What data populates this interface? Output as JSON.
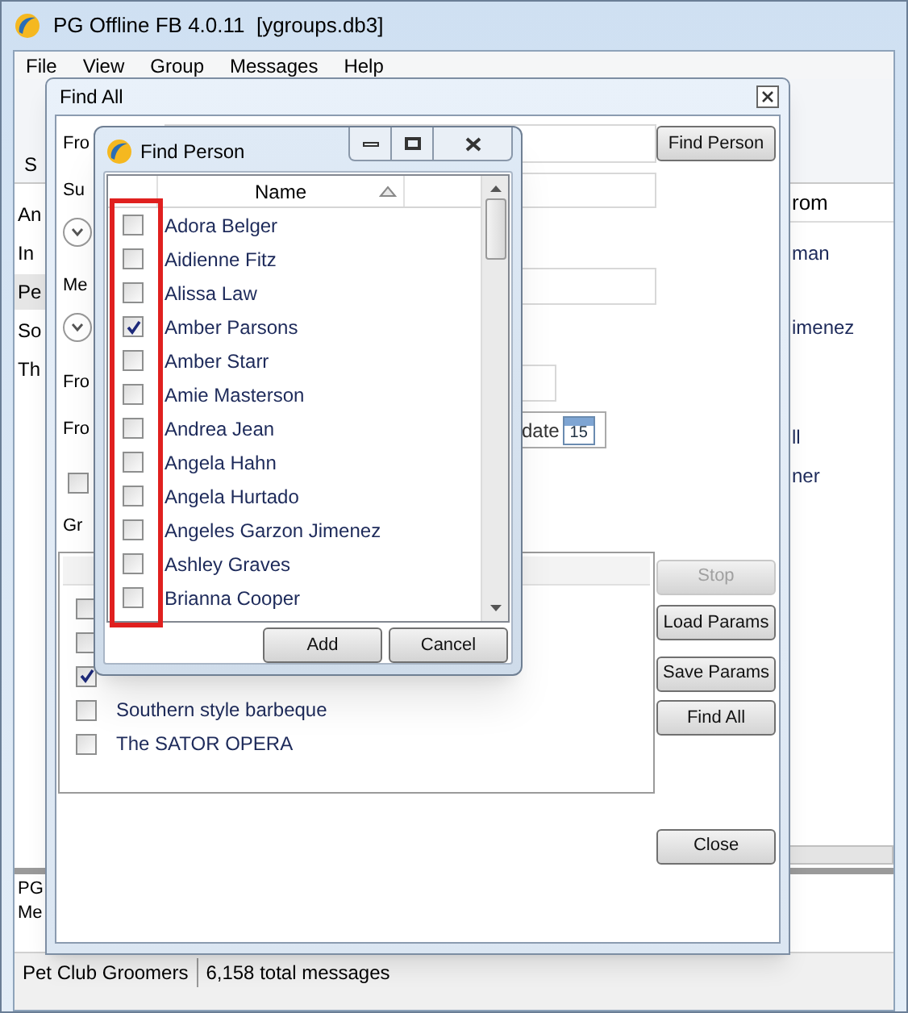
{
  "main_window": {
    "title": "PG Offline FB 4.0.11  [ygroups.db3]",
    "menu": [
      "File",
      "View",
      "Group",
      "Messages",
      "Help"
    ],
    "toolbar_fragment": "S",
    "sidebar_items": [
      {
        "label": "An",
        "selected": false
      },
      {
        "label": "In",
        "selected": false
      },
      {
        "label": "Pe",
        "selected": true
      },
      {
        "label": "So",
        "selected": false
      },
      {
        "label": "Th",
        "selected": false
      }
    ],
    "list_header": "rom",
    "list_items": [
      "man",
      "imenez",
      "ll",
      "ner"
    ],
    "preview_lines": [
      "PG",
      "Me"
    ],
    "status_bar": [
      "Pet Club Groomers",
      "6,158 total messages"
    ]
  },
  "find_all": {
    "title": "Find All",
    "labels": [
      "Fro",
      "Su",
      "Me",
      "Fro",
      "Fro"
    ],
    "find_person_button": "Find Person",
    "date_fragment": "date",
    "calendar_day": "15",
    "option_checked": false,
    "groups_label": "Gr",
    "groups": [
      {
        "checked": false
      },
      {
        "checked": false
      },
      {
        "checked": true
      },
      {
        "label": "Southern style barbeque",
        "checked": false
      },
      {
        "label": "The SATOR OPERA",
        "checked": false
      }
    ],
    "buttons": [
      {
        "label": "Stop",
        "disabled": true
      },
      {
        "label": "Load Params",
        "disabled": false
      },
      {
        "label": "Save Params",
        "disabled": false
      },
      {
        "label": "Find All",
        "disabled": false
      },
      {
        "label": "Close",
        "disabled": false
      }
    ]
  },
  "find_person": {
    "title": "Find Person",
    "column": "Name",
    "people": [
      {
        "name": "Adora Belger",
        "checked": false
      },
      {
        "name": "Aidienne Fitz",
        "checked": false
      },
      {
        "name": "Alissa Law",
        "checked": false
      },
      {
        "name": "Amber Parsons",
        "checked": true
      },
      {
        "name": "Amber Starr",
        "checked": false
      },
      {
        "name": "Amie Masterson",
        "checked": false
      },
      {
        "name": "Andrea Jean",
        "checked": false
      },
      {
        "name": "Angela Hahn",
        "checked": false
      },
      {
        "name": "Angela Hurtado",
        "checked": false
      },
      {
        "name": "Angeles Garzon Jimenez",
        "checked": false
      },
      {
        "name": "Ashley Graves",
        "checked": false
      },
      {
        "name": "Brianna Cooper",
        "checked": false
      }
    ],
    "buttons": [
      "Add",
      "Cancel"
    ]
  }
}
